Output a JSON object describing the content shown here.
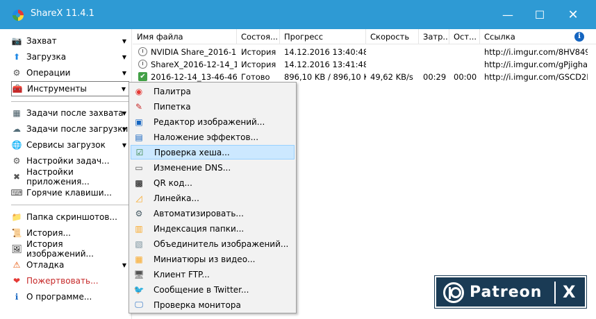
{
  "window": {
    "title": "ShareX 11.4.1",
    "minimize": "—",
    "maximize": "☐",
    "close": "✕"
  },
  "sidebar": {
    "items": [
      {
        "label": "Захват",
        "icon": "camera-icon",
        "glyph": "📷",
        "arrow": "▼"
      },
      {
        "label": "Загрузка",
        "icon": "upload-arrow-icon",
        "glyph": "⬆",
        "arrow": "▼"
      },
      {
        "label": "Операции",
        "icon": "workflow-icon",
        "glyph": "⚙",
        "arrow": "▼"
      },
      {
        "label": "Инструменты",
        "icon": "toolbox-icon",
        "glyph": "🧰",
        "arrow": "▼"
      },
      {
        "label": "Задачи после захвата",
        "icon": "after-capture-icon",
        "glyph": "▦",
        "arrow": "▼"
      },
      {
        "label": "Задачи после загрузки",
        "icon": "after-upload-icon",
        "glyph": "☁",
        "arrow": "▼"
      },
      {
        "label": "Сервисы загрузок",
        "icon": "globe-icon",
        "glyph": "🌐",
        "arrow": "▼"
      },
      {
        "label": "Настройки задач...",
        "icon": "task-settings-icon",
        "glyph": "⚙",
        "arrow": ""
      },
      {
        "label": "Настройки приложения...",
        "icon": "tools-icon",
        "glyph": "✖",
        "arrow": ""
      },
      {
        "label": "Горячие клавиши...",
        "icon": "keyboard-icon",
        "glyph": "⌨",
        "arrow": ""
      },
      {
        "label": "Папка скриншотов...",
        "icon": "folder-icon",
        "glyph": "📁",
        "arrow": ""
      },
      {
        "label": "История...",
        "icon": "history-icon",
        "glyph": "📜",
        "arrow": ""
      },
      {
        "label": "История изображений...",
        "icon": "image-history-icon",
        "glyph": "🖼",
        "arrow": ""
      },
      {
        "label": "Отладка",
        "icon": "warning-icon",
        "glyph": "⚠",
        "arrow": "▼"
      },
      {
        "label": "Пожертвовать...",
        "icon": "heart-icon",
        "glyph": "❤",
        "arrow": ""
      },
      {
        "label": "О программе...",
        "icon": "about-icon",
        "glyph": "ℹ",
        "arrow": ""
      }
    ]
  },
  "table": {
    "columns": [
      "Имя файла",
      "Состоя...",
      "Прогресс",
      "Скорость",
      "Затр...",
      "Ост...",
      "Ссылка"
    ],
    "info_glyph": "i",
    "rows": [
      {
        "status_icon": "clock-icon",
        "name": "NVIDIA Share_2016-12-...",
        "state": "История",
        "progress": "14.12.2016 13:40:48",
        "speed": "",
        "elapsed": "",
        "remaining": "",
        "url": "http://i.imgur.com/8HV849..."
      },
      {
        "status_icon": "clock-icon",
        "name": "ShareX_2016-12-14_13-...",
        "state": "История",
        "progress": "14.12.2016 13:41:48",
        "speed": "",
        "elapsed": "",
        "remaining": "",
        "url": "http://i.imgur.com/gPjigha..."
      },
      {
        "status_icon": "check-icon",
        "name": "2016-12-14_13-46-46.gif",
        "state": "Готово",
        "progress": "896,10 KB / 896,10 KB",
        "speed": "49,62 KB/s",
        "elapsed": "00:29",
        "remaining": "00:00",
        "url": "http://i.imgur.com/GSCD2L..."
      }
    ]
  },
  "tools_menu": {
    "items": [
      {
        "label": "Палитра",
        "icon": "color-wheel-icon",
        "glyph": "◉"
      },
      {
        "label": "Пипетка",
        "icon": "eyedropper-icon",
        "glyph": "✎"
      },
      {
        "label": "Редактор изображений...",
        "icon": "image-editor-icon",
        "glyph": "▣"
      },
      {
        "label": "Наложение эффектов...",
        "icon": "effects-icon",
        "glyph": "▤"
      },
      {
        "label": "Проверка хеша...",
        "icon": "hash-check-icon",
        "glyph": "☑"
      },
      {
        "label": "Изменение DNS...",
        "icon": "dns-icon",
        "glyph": "▭"
      },
      {
        "label": "QR код...",
        "icon": "qr-code-icon",
        "glyph": "▩"
      },
      {
        "label": "Линейка...",
        "icon": "ruler-icon",
        "glyph": "◿"
      },
      {
        "label": "Автоматизировать...",
        "icon": "automate-icon",
        "glyph": "⚙"
      },
      {
        "label": "Индексация папки...",
        "icon": "index-folder-icon",
        "glyph": "▥"
      },
      {
        "label": "Объединитель изображений...",
        "icon": "image-combiner-icon",
        "glyph": "▧"
      },
      {
        "label": "Миниатюры из видео...",
        "icon": "video-thumbnails-icon",
        "glyph": "▦"
      },
      {
        "label": "Клиент FTP...",
        "icon": "ftp-client-icon",
        "glyph": "🖥"
      },
      {
        "label": "Сообщение в Twitter...",
        "icon": "twitter-icon",
        "glyph": "🐦"
      },
      {
        "label": "Проверка монитора",
        "icon": "monitor-icon",
        "glyph": "🖵"
      }
    ],
    "highlighted_index": 4
  },
  "banner": {
    "text": "Patreon",
    "x_label": "X"
  },
  "colors": {
    "titlebar": "#2e9ad4",
    "highlight": "#cce8ff",
    "banner": "#1a3b55",
    "danger_text": "#c62828"
  }
}
